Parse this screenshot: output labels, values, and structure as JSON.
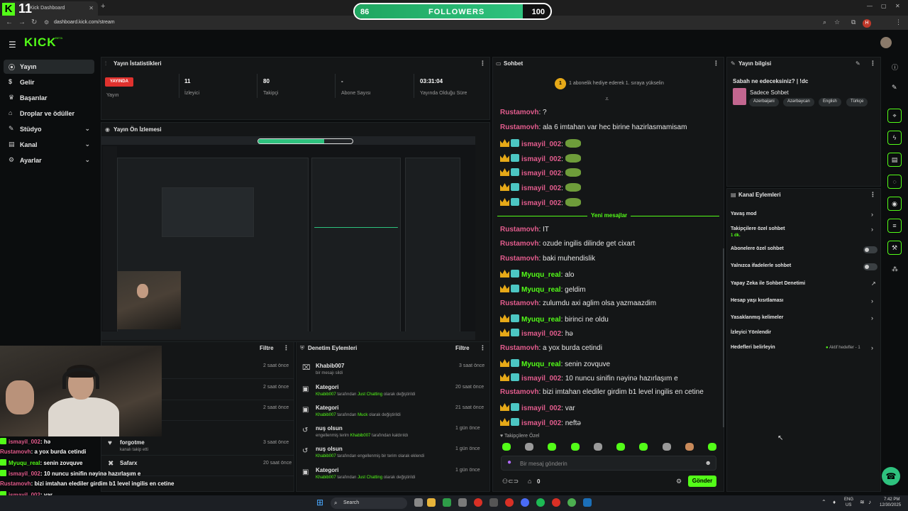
{
  "browser": {
    "tab_title": "Kick Dashboard",
    "url": "dashboard.kick.com/stream",
    "profile_initial": "H"
  },
  "overlay": {
    "kick_count": "11",
    "followers_current": "86",
    "followers_label": "FOLLOWERS",
    "followers_goal": "100",
    "followers_progress": 0.86
  },
  "header": {
    "logo": "KICK",
    "logo_beta": "BETA"
  },
  "sidebar": {
    "items": [
      {
        "label": "Yayın",
        "icon": "broadcast-icon",
        "active": true
      },
      {
        "label": "Gelir",
        "icon": "dollar-icon"
      },
      {
        "label": "Başarılar",
        "icon": "trophy-icon"
      },
      {
        "label": "Droplar ve ödüller",
        "icon": "gift-icon"
      },
      {
        "label": "Stüdyo",
        "icon": "palette-icon",
        "expandable": true
      },
      {
        "label": "Kanal",
        "icon": "channel-icon",
        "expandable": true
      },
      {
        "label": "Ayarlar",
        "icon": "gear-icon",
        "expandable": true
      }
    ]
  },
  "stats": {
    "title": "Yayın İstatistikleri",
    "live_badge": "YAYINDA",
    "status_label": "Yayın",
    "items": [
      {
        "value": "11",
        "label": "İzleyici"
      },
      {
        "value": "80",
        "label": "Takipçi"
      },
      {
        "value": "-",
        "label": "Abone Sayısı"
      },
      {
        "value": "03:31:04",
        "label": "Yayında Olduğu Süre"
      }
    ]
  },
  "preview": {
    "title": "Yayın Ön İzlemesi"
  },
  "activity": {
    "filter_label": "Filtre",
    "rows": [
      {
        "time": "2 saat önce"
      },
      {
        "time": "2 saat önce"
      },
      {
        "time": "2 saat önce"
      },
      {
        "title": "forgotme",
        "sub": "kanalı takip etti",
        "time": "3 saat önce"
      },
      {
        "title": "Safarx",
        "sub": "",
        "time": "20 saat önce"
      }
    ]
  },
  "moderation": {
    "title": "Denetim Eylemleri",
    "filter_label": "Filtre",
    "rows": [
      {
        "title": "Khabib007",
        "sub1": "bir mesajı sildi",
        "subg": "",
        "sub2": "",
        "subg2": "",
        "sub3": "",
        "time": "3 saat önce"
      },
      {
        "title": "Kategori",
        "sub1": "",
        "subg": "Khabib007",
        "sub2": " tarafından ",
        "subg2": "Just Chatting",
        "sub3": " olarak değiştirildi",
        "time": "20 saat önce"
      },
      {
        "title": "Kategori",
        "sub1": "",
        "subg": "Khabib007",
        "sub2": " tarafından ",
        "subg2": "Muck",
        "sub3": " olarak değiştirildi",
        "time": "21 saat önce"
      },
      {
        "title": "nuş olsun",
        "sub1": "engellenmiş terim ",
        "subg": "Khabib007",
        "sub2": " tarafından kaldırıldı",
        "subg2": "",
        "sub3": "",
        "time": "1 gün önce"
      },
      {
        "title": "nuş olsun",
        "sub1": "",
        "subg": "Khabib007",
        "sub2": " tarafından engellenmiş bir terim olarak eklendi",
        "subg2": "",
        "sub3": "",
        "time": "1 gün önce"
      },
      {
        "title": "Kategori",
        "sub1": "",
        "subg": "Khabib007",
        "sub2": " tarafından ",
        "subg2": "Just Chatting",
        "sub3": " olarak değiştirildi",
        "time": "1 gün önce"
      }
    ]
  },
  "chat": {
    "title": "Sohbet",
    "pinned": "1 abonelik hediye ederek 1. sıraya yükselin",
    "pinned_rank": "1",
    "new_messages_label": "Yeni mesajlar",
    "messages": [
      {
        "user": "Rustamovh",
        "text": "?",
        "color": "pink",
        "badges": false
      },
      {
        "user": "Rustamovh",
        "text": "ala 6 imtahan var hec birine hazirlasmamisam",
        "color": "pink",
        "badges": false
      },
      {
        "user": "ismayil_002",
        "text": "",
        "color": "pink",
        "badges": true,
        "emote": true
      },
      {
        "user": "ismayil_002",
        "text": "",
        "color": "pink",
        "badges": true,
        "emote": true
      },
      {
        "user": "ismayil_002",
        "text": "",
        "color": "pink",
        "badges": true,
        "emote": true
      },
      {
        "user": "ismayil_002",
        "text": "",
        "color": "pink",
        "badges": true,
        "emote": true
      },
      {
        "user": "ismayil_002",
        "text": "",
        "color": "pink",
        "badges": true,
        "emote": true
      },
      {
        "user": "Rustamovh",
        "text": "IT",
        "color": "pink",
        "badges": false
      },
      {
        "user": "Rustamovh",
        "text": "ozude ingilis dilinde get cixart",
        "color": "pink",
        "badges": false
      },
      {
        "user": "Rustamovh",
        "text": "baki muhendislik",
        "color": "pink",
        "badges": false
      },
      {
        "user": "Myuqu_real",
        "text": "alo",
        "color": "green",
        "badges": true
      },
      {
        "user": "Myuqu_real",
        "text": "geldim",
        "color": "green",
        "badges": true
      },
      {
        "user": "Rustamovh",
        "text": "zulumdu axi aglim olsa yazmaazdim",
        "color": "pink",
        "badges": false
      },
      {
        "user": "Myuqu_real",
        "text": "birinci ne oldu",
        "color": "green",
        "badges": true
      },
      {
        "user": "ismayil_002",
        "text": "hə",
        "color": "pink",
        "badges": true
      },
      {
        "user": "Rustamovh",
        "text": "a yox burda cetindi",
        "color": "pink",
        "badges": false
      },
      {
        "user": "Myuqu_real",
        "text": "senin zovquve",
        "color": "green",
        "badges": true
      },
      {
        "user": "ismayil_002",
        "text": "10 nuncu sinifin nəyinə hazırlaşım e",
        "color": "pink",
        "badges": true
      },
      {
        "user": "Rustamovh",
        "text": "bizi imtahan elediler girdim b1 level ingilis en cetine",
        "color": "pink",
        "badges": false
      },
      {
        "user": "ismayil_002",
        "text": "var",
        "color": "pink",
        "badges": true
      },
      {
        "user": "ismayil_002",
        "text": "neftə",
        "color": "pink",
        "badges": true
      }
    ],
    "followers_only_label": "Takipçilere Özel",
    "input_placeholder": "Bir mesaj gönderin",
    "viewer_count": "0",
    "send_label": "Gönder"
  },
  "stream_info": {
    "title": "Yayın bilgisi",
    "stream_title": "Sabah ne edeceksiniz? | !dc",
    "category": "Sadece Sohbet",
    "tags": [
      "Azerbaijani",
      "Azərbaycan",
      "English",
      "Türkçe"
    ]
  },
  "channel_actions": {
    "title": "Kanal Eylemleri",
    "items": [
      {
        "label": "Yavaş mod",
        "control": "arrow"
      },
      {
        "label": "Takipçilere özel sohbet",
        "sub": "1 dk.",
        "control": "arrow"
      },
      {
        "label": "Abonelere özel sohbet",
        "control": "toggle"
      },
      {
        "label": "Yalnızca ifadelerle sohbet",
        "control": "toggle"
      },
      {
        "label": "Yapay Zeka ile Sohbet Denetimi",
        "control": "external"
      },
      {
        "label": "Hesap yaşı kısıtlaması",
        "control": "arrow"
      },
      {
        "label": "Yasaklanmış kelimeler",
        "control": "arrow"
      },
      {
        "label": "İzleyici Yönlendir",
        "control": "none"
      },
      {
        "label": "Hedefleri belirleyin",
        "status": "Aktif hedefler - 1",
        "control": "arrow"
      }
    ]
  },
  "overlay_chat": [
    {
      "user": "ismayil_002",
      "text": "hə",
      "color": "#e25c8d"
    },
    {
      "user": "Rustamovh",
      "text": "a yox burda cetindi",
      "color": "#e25c8d"
    },
    {
      "user": "Myuqu_real",
      "text": "senin zovquve",
      "color": "#53fc18"
    },
    {
      "user": "ismayil_002",
      "text": "10 nuncu sinifin nəyinə hazırlaşım e",
      "color": "#e25c8d"
    },
    {
      "user": "Rustamovh",
      "text": "bizi imtahan elediler girdim b1 level ingilis en cetine",
      "color": "#e25c8d"
    },
    {
      "user": "ismayil_002",
      "text": "var",
      "color": "#e25c8d"
    },
    {
      "user": "ismayil_002",
      "text": "neftə",
      "color": "#e25c8d"
    }
  ],
  "taskbar": {
    "search_placeholder": "Search",
    "lang": "ENG",
    "region": "US",
    "time": "7:42 PM",
    "date": "12/30/2025"
  },
  "colors": {
    "accent": "#53fc18",
    "live": "#e0322e",
    "username_pink": "#e25c8d"
  }
}
